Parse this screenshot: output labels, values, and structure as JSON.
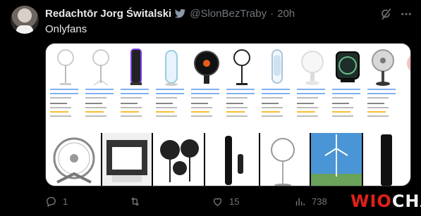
{
  "tweet": {
    "author_name": "Redachtōr Jorg Świtalski",
    "handle": "@SlonBezTraby",
    "separator": "·",
    "time": "20h",
    "text": "Onlyfans"
  },
  "actions": {
    "reply_count": "1",
    "retweet_count": "",
    "like_count": "15",
    "views_count": "738"
  },
  "watermark": "WIOCHA",
  "colors": {
    "background": "#000000",
    "text": "#e7e9ea",
    "muted": "#71767b",
    "verified": "#8b98a5",
    "watermark_red": "#e0201b"
  },
  "icons": [
    "verified-bird-icon",
    "grok-icon",
    "more-icon",
    "reply-icon",
    "retweet-icon",
    "like-icon",
    "views-icon",
    "bookmark-icon",
    "share-icon"
  ]
}
